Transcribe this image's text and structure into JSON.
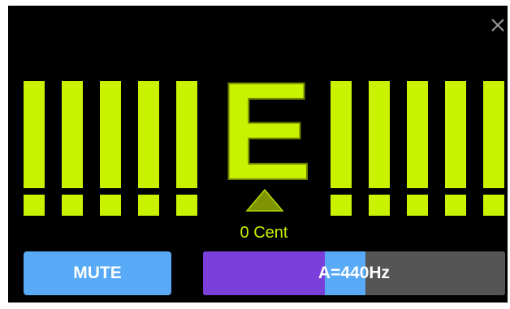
{
  "close": {
    "icon": "close-icon"
  },
  "tuner": {
    "note": "E",
    "cent_readout": "0 Cent",
    "cents": 0,
    "indicator_icon": "triangle-up-icon",
    "active_color": "#c8f200"
  },
  "controls": {
    "mute_label": "MUTE",
    "reference_label": "A=440Hz",
    "reference_hz": 440,
    "mute_color": "#58a9f6",
    "slider_fill_color": "#7b3fdc",
    "slider_track_color": "#555555"
  }
}
